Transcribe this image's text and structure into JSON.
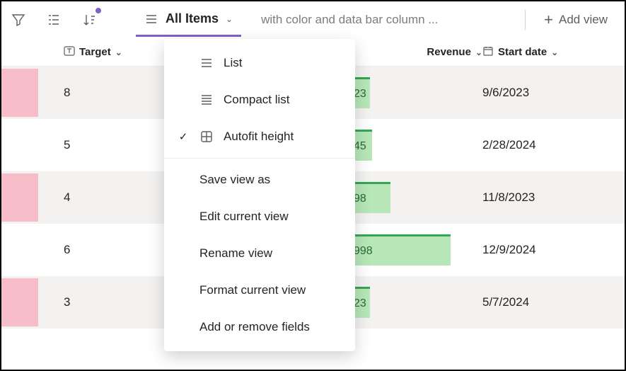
{
  "toolbar": {
    "view_label": "All Items",
    "view_description": "with color and data bar column ...",
    "add_view_label": "Add view"
  },
  "columns": {
    "target": "Target",
    "revenue": "Revenue",
    "start_date": "Start date"
  },
  "menu": {
    "list": "List",
    "compact": "Compact list",
    "autofit": "Autofit height",
    "save_as": "Save view as",
    "edit": "Edit current view",
    "rename": "Rename view",
    "format": "Format current view",
    "fields": "Add or remove fields"
  },
  "rows": [
    {
      "color": "pink",
      "target": "8",
      "revenue_text": "23",
      "bar_pct": 18,
      "date": "9/6/2023",
      "shaded": true
    },
    {
      "color": "",
      "target": "5",
      "revenue_text": "45",
      "bar_pct": 20,
      "date": "2/28/2024",
      "shaded": false
    },
    {
      "color": "pink",
      "target": "4",
      "revenue_text": "98",
      "bar_pct": 35,
      "date": "11/8/2023",
      "shaded": true
    },
    {
      "color": "",
      "target": "6",
      "revenue_text": "998",
      "bar_pct": 85,
      "date": "12/9/2024",
      "shaded": false
    },
    {
      "color": "pink",
      "target": "3",
      "revenue_text": "23",
      "bar_pct": 18,
      "date": "5/7/2024",
      "shaded": true
    }
  ]
}
